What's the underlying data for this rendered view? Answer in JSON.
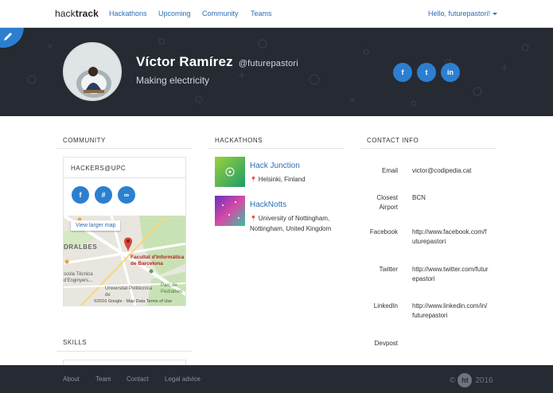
{
  "nav": {
    "brand_light": "hack",
    "brand_bold": "track",
    "links": [
      "Hackathons",
      "Upcoming",
      "Community",
      "Teams"
    ],
    "user_greeting": "Hello, futurepastori!"
  },
  "profile": {
    "name": "Víctor Ramírez",
    "handle": "@futurepastori",
    "bio": "Making electricity",
    "social": [
      {
        "icon": "facebook-icon",
        "glyph": "f"
      },
      {
        "icon": "twitter-icon",
        "glyph": "t"
      },
      {
        "icon": "linkedin-icon",
        "glyph": "in"
      }
    ]
  },
  "community": {
    "title": "COMMUNITY",
    "panel_title": "HACKERS@UPC",
    "buttons": [
      {
        "icon": "facebook-icon",
        "glyph": "f"
      },
      {
        "icon": "slack-icon",
        "glyph": "#"
      },
      {
        "icon": "link-icon",
        "glyph": "∞"
      }
    ],
    "map": {
      "view_larger": "View larger map",
      "label_area": "DRALBES",
      "label_faculty": "Facultat d'Informàtica de Barcelona",
      "label_escola": "scola Tècnica d'Enginyers...",
      "label_universitat": "Universitat Politècnica de",
      "label_parc": "Parc de Pedralbes",
      "footer": "©2016 Google · Map Data    Terms of Use"
    }
  },
  "hackathons": {
    "title": "HACKATHONS",
    "items": [
      {
        "name": "Hack Junction",
        "location": "Helsinki, Finland"
      },
      {
        "name": "HackNotts",
        "location": "University of Nottingham, Nottingham, United Kingdom"
      }
    ]
  },
  "contact": {
    "title": "CONTACT INFO",
    "rows": [
      {
        "label": "Email",
        "value": "victor@codipedia.cat"
      },
      {
        "label": "Closest Airport",
        "value": "BCN"
      },
      {
        "label": "Facebook",
        "value": "http://www.facebook.com/futurepastori"
      },
      {
        "label": "Twitter",
        "value": "http://www.twitter.com/futurepastori"
      },
      {
        "label": "LinkedIn",
        "value": "http://www.linkedin.com/in/futurepastori"
      },
      {
        "label": "Devpost",
        "value": ""
      }
    ]
  },
  "skills": {
    "title": "SKILLS"
  },
  "footer": {
    "links": [
      "About",
      "Team",
      "Contact",
      "Legal advice"
    ],
    "copyright_prefix": "©",
    "logo_text": "ht",
    "year": "2016"
  },
  "colors": {
    "accent": "#2c7fd0",
    "hero_bg": "#262a33",
    "link": "#2b6db3"
  }
}
